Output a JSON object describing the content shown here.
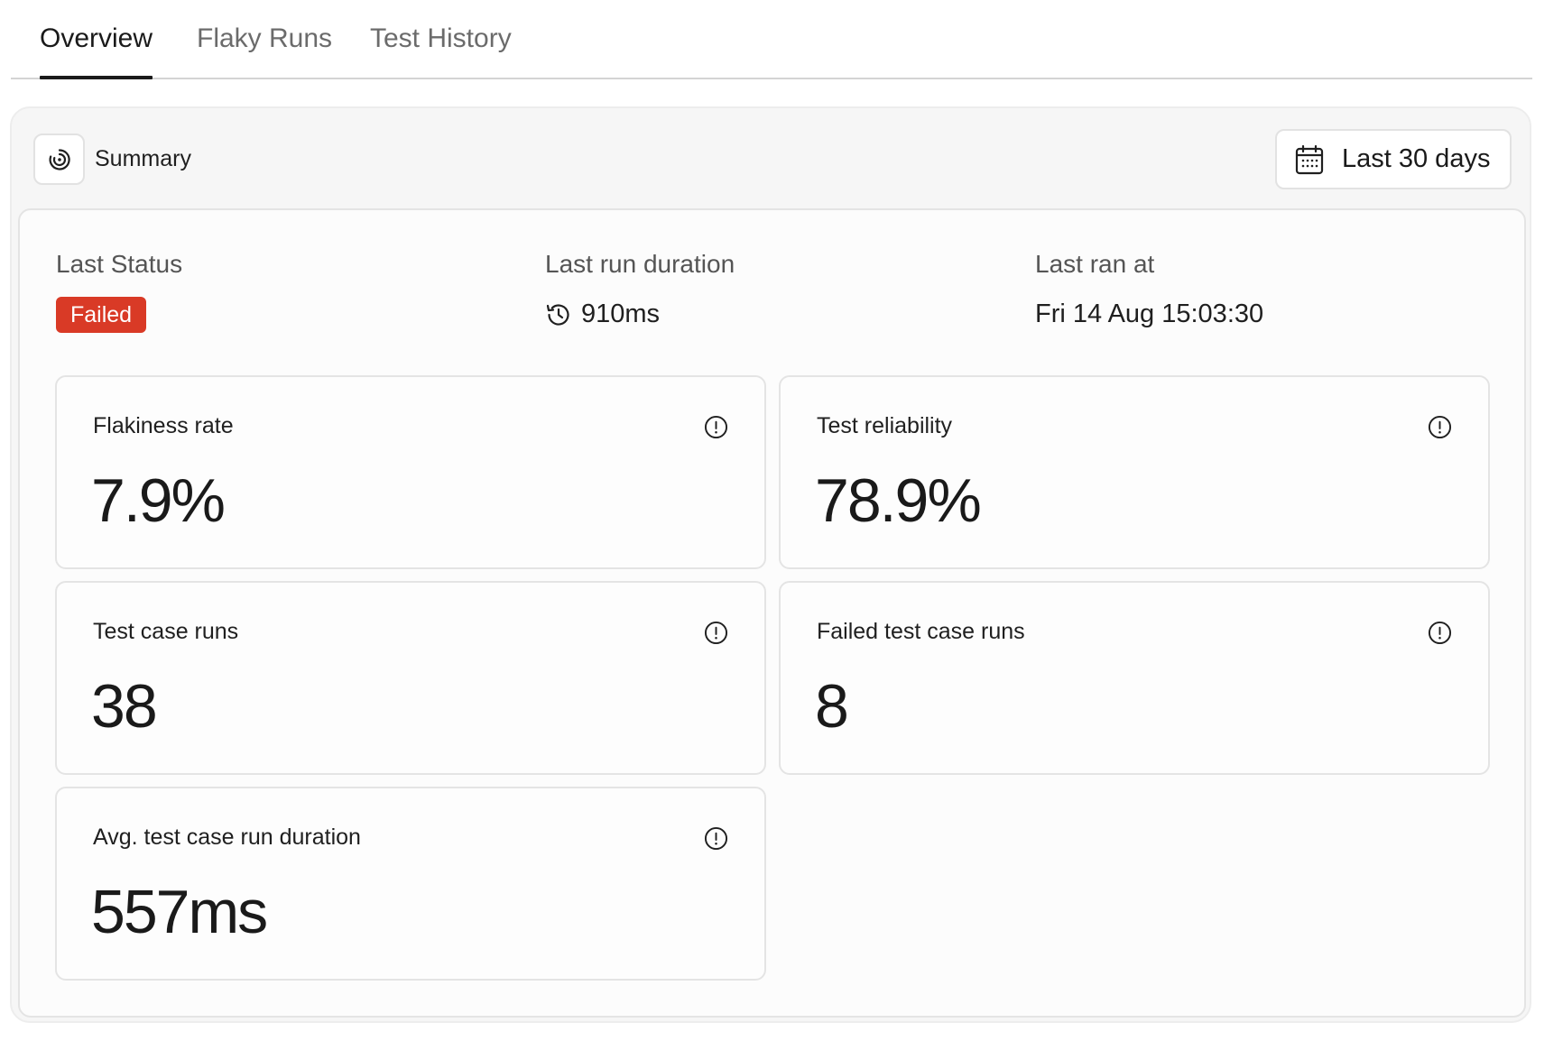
{
  "tabs": [
    {
      "label": "Overview",
      "active": true
    },
    {
      "label": "Flaky Runs",
      "active": false
    },
    {
      "label": "Test History",
      "active": false
    }
  ],
  "summary": {
    "label": "Summary",
    "icon": "summary-spiral-icon"
  },
  "date_range": {
    "label": "Last 30 days",
    "icon": "calendar-icon"
  },
  "last_status": {
    "label": "Last Status",
    "value": "Failed",
    "color": "#d93a26"
  },
  "last_run_duration": {
    "label": "Last run duration",
    "value": "910ms",
    "icon": "history-icon"
  },
  "last_ran_at": {
    "label": "Last ran at",
    "value": "Fri 14 Aug 15:03:30"
  },
  "metrics": [
    {
      "title": "Flakiness rate",
      "value": "7.9%",
      "icon": "info-icon"
    },
    {
      "title": "Test reliability",
      "value": "78.9%",
      "icon": "info-icon"
    },
    {
      "title": "Test case runs",
      "value": "38",
      "icon": "info-icon"
    },
    {
      "title": "Failed test case runs",
      "value": "8",
      "icon": "info-icon"
    },
    {
      "title": "Avg. test case run duration",
      "value": "557ms",
      "icon": "info-icon"
    }
  ]
}
